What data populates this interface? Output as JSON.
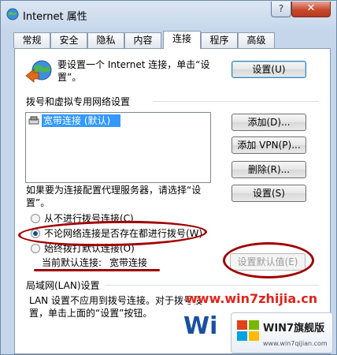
{
  "window": {
    "title": "Internet 属性"
  },
  "tabs": [
    {
      "label": "常规"
    },
    {
      "label": "安全"
    },
    {
      "label": "隐私"
    },
    {
      "label": "内容"
    },
    {
      "label": "连接"
    },
    {
      "label": "程序"
    },
    {
      "label": "高级"
    }
  ],
  "active_tab": "连接",
  "setup": {
    "text_line1": "要设置一个 Internet 连接，单击“设",
    "text_line2": "置”。",
    "button": "设置(U)"
  },
  "dialup": {
    "group_label": "拨号和虚拟专用网络设置",
    "connections": [
      {
        "label": "宽带连接 (默认)",
        "selected": true
      }
    ],
    "add_button": "添加(D)...",
    "add_vpn_button": "添加 VPN(P)...",
    "delete_button": "删除(R)...",
    "settings_button": "设置(S)",
    "proxy_text_line1": "如果要为连接配置代理服务器，请选择“设",
    "proxy_text_line2": "置”。",
    "options": [
      {
        "label": "从不进行拨号连接(C)",
        "checked": false
      },
      {
        "label": "不论网络连接是否存在都进行拨号(W)",
        "checked": true
      },
      {
        "label": "始终拨打默认连接(O)",
        "checked": false
      }
    ],
    "current_default_label": "当前默认连接:",
    "current_default_value": "宽带连接",
    "set_default_button": "设置默认值(E)"
  },
  "lan": {
    "group_label": "局域网(LAN)设置",
    "text_line1": "LAN 设置不应用到拨号连接。对于拨号设",
    "text_line2": "置，单击上面的“设置”按钮。"
  },
  "watermark": {
    "site": "www.win7zhijia.cn",
    "badge_title": "WIN7旗舰版",
    "badge_url": "www.win7qijian.com"
  },
  "colors": {
    "annotation": "#a00000",
    "selection": "#3399ff",
    "default_button": "#3c7fb1"
  }
}
